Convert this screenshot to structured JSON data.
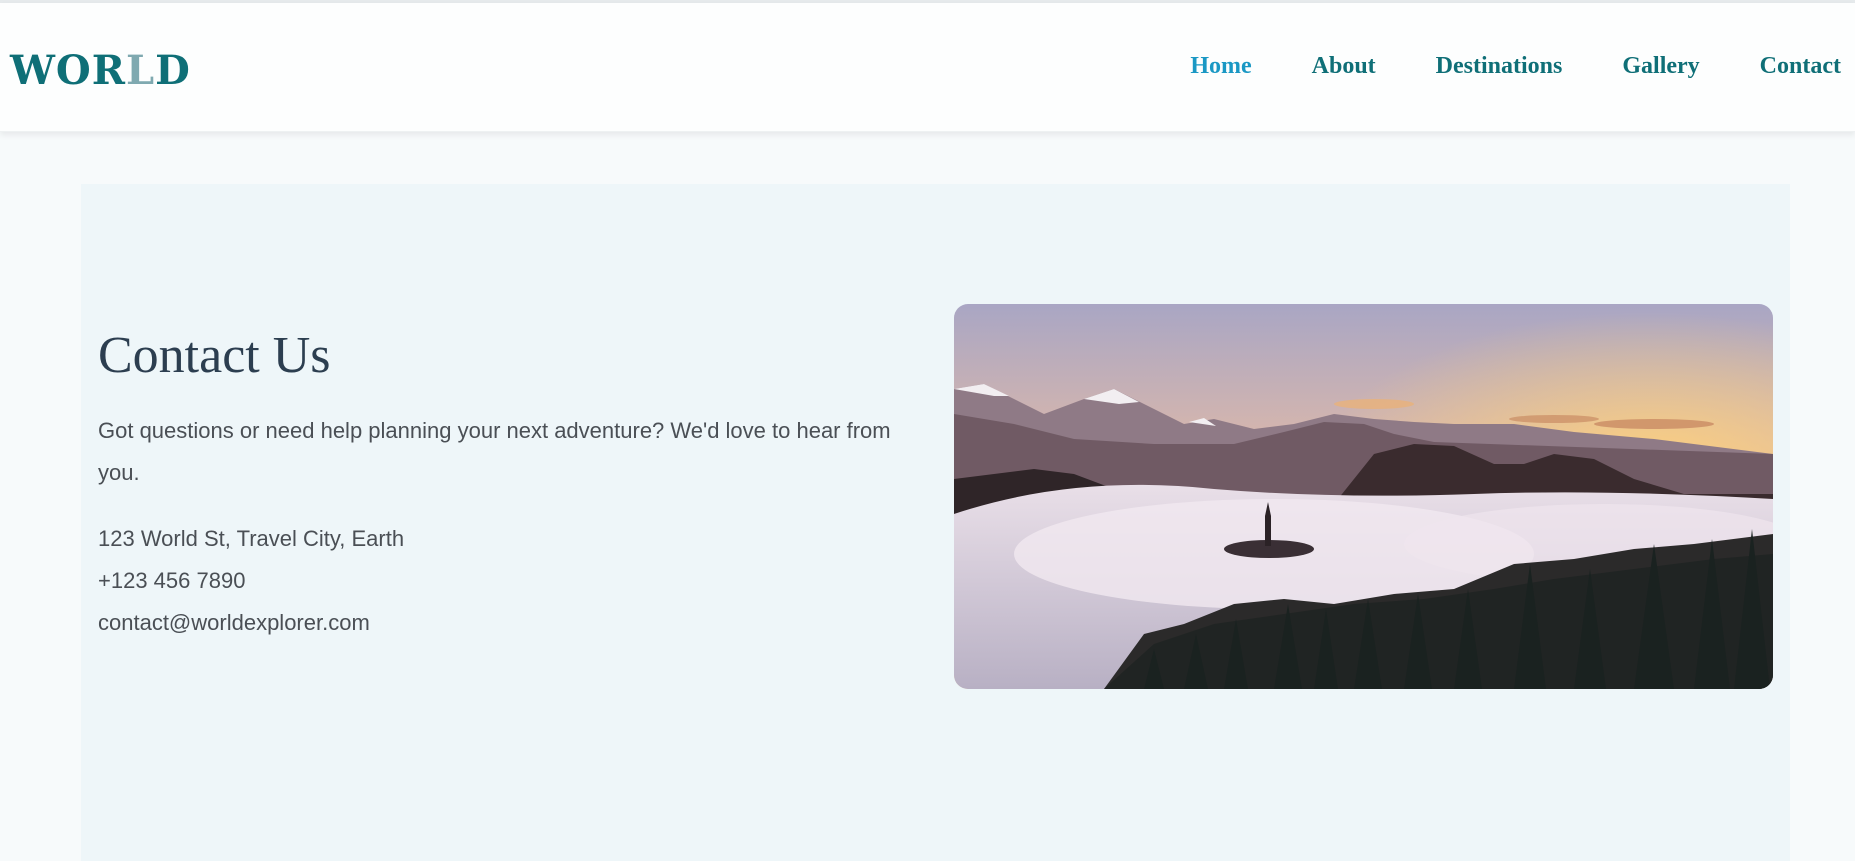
{
  "logo": {
    "text_main": "WOR",
    "text_lite": "L",
    "text_end": "D"
  },
  "nav": {
    "items": [
      "Home",
      "About",
      "Destinations",
      "Gallery",
      "Contact"
    ],
    "active": "Home"
  },
  "contact": {
    "title": "Contact Us",
    "description": "Got questions or need help planning your next adventure? We'd love to hear from you.",
    "address": "123 World St, Travel City, Earth",
    "phone": "+123 456 7890",
    "email": "contact@worldexplorer.com"
  },
  "hero_image": {
    "subject": "misty-mountain-lake-sunrise-image"
  },
  "colors": {
    "brand": "#0f6f77",
    "active_nav": "#1a98c4",
    "heading": "#2c3e50",
    "panel_bg": "#eef6f9"
  }
}
